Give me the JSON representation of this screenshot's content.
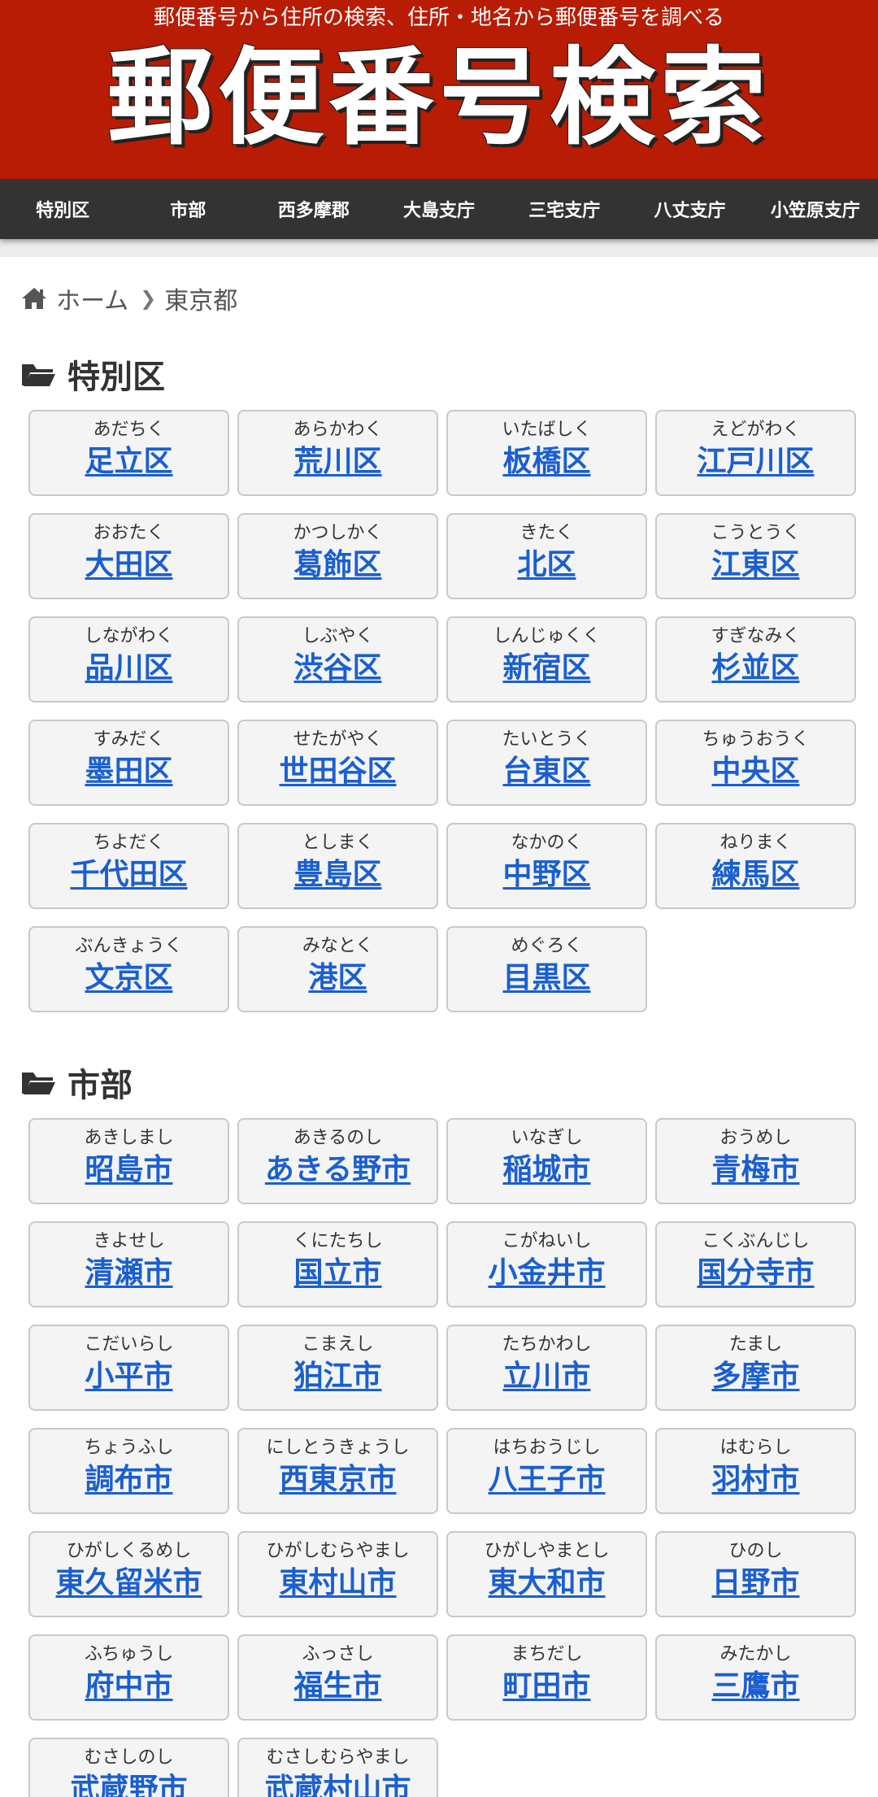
{
  "header": {
    "tagline": "郵便番号から住所の検索、住所・地名から郵便番号を調べる",
    "title": "郵便番号検索"
  },
  "nav": [
    "特別区",
    "市部",
    "西多摩郡",
    "大島支庁",
    "三宅支庁",
    "八丈支庁",
    "小笠原支庁"
  ],
  "breadcrumb": {
    "home": "ホーム",
    "current": "東京都"
  },
  "sections": [
    {
      "title": "特別区",
      "items": [
        {
          "kana": "あだちく",
          "name": "足立区"
        },
        {
          "kana": "あらかわく",
          "name": "荒川区"
        },
        {
          "kana": "いたばしく",
          "name": "板橋区"
        },
        {
          "kana": "えどがわく",
          "name": "江戸川区"
        },
        {
          "kana": "おおたく",
          "name": "大田区"
        },
        {
          "kana": "かつしかく",
          "name": "葛飾区"
        },
        {
          "kana": "きたく",
          "name": "北区"
        },
        {
          "kana": "こうとうく",
          "name": "江東区"
        },
        {
          "kana": "しながわく",
          "name": "品川区"
        },
        {
          "kana": "しぶやく",
          "name": "渋谷区"
        },
        {
          "kana": "しんじゅくく",
          "name": "新宿区"
        },
        {
          "kana": "すぎなみく",
          "name": "杉並区"
        },
        {
          "kana": "すみだく",
          "name": "墨田区"
        },
        {
          "kana": "せたがやく",
          "name": "世田谷区"
        },
        {
          "kana": "たいとうく",
          "name": "台東区"
        },
        {
          "kana": "ちゅうおうく",
          "name": "中央区"
        },
        {
          "kana": "ちよだく",
          "name": "千代田区"
        },
        {
          "kana": "としまく",
          "name": "豊島区"
        },
        {
          "kana": "なかのく",
          "name": "中野区"
        },
        {
          "kana": "ねりまく",
          "name": "練馬区"
        },
        {
          "kana": "ぶんきょうく",
          "name": "文京区"
        },
        {
          "kana": "みなとく",
          "name": "港区"
        },
        {
          "kana": "めぐろく",
          "name": "目黒区"
        }
      ]
    },
    {
      "title": "市部",
      "items": [
        {
          "kana": "あきしまし",
          "name": "昭島市"
        },
        {
          "kana": "あきるのし",
          "name": "あきる野市"
        },
        {
          "kana": "いなぎし",
          "name": "稲城市"
        },
        {
          "kana": "おうめし",
          "name": "青梅市"
        },
        {
          "kana": "きよせし",
          "name": "清瀬市"
        },
        {
          "kana": "くにたちし",
          "name": "国立市"
        },
        {
          "kana": "こがねいし",
          "name": "小金井市"
        },
        {
          "kana": "こくぶんじし",
          "name": "国分寺市"
        },
        {
          "kana": "こだいらし",
          "name": "小平市"
        },
        {
          "kana": "こまえし",
          "name": "狛江市"
        },
        {
          "kana": "たちかわし",
          "name": "立川市"
        },
        {
          "kana": "たまし",
          "name": "多摩市"
        },
        {
          "kana": "ちょうふし",
          "name": "調布市"
        },
        {
          "kana": "にしとうきょうし",
          "name": "西東京市"
        },
        {
          "kana": "はちおうじし",
          "name": "八王子市"
        },
        {
          "kana": "はむらし",
          "name": "羽村市"
        },
        {
          "kana": "ひがしくるめし",
          "name": "東久留米市"
        },
        {
          "kana": "ひがしむらやまし",
          "name": "東村山市"
        },
        {
          "kana": "ひがしやまとし",
          "name": "東大和市"
        },
        {
          "kana": "ひのし",
          "name": "日野市"
        },
        {
          "kana": "ふちゅうし",
          "name": "府中市"
        },
        {
          "kana": "ふっさし",
          "name": "福生市"
        },
        {
          "kana": "まちだし",
          "name": "町田市"
        },
        {
          "kana": "みたかし",
          "name": "三鷹市"
        },
        {
          "kana": "むさしのし",
          "name": "武蔵野市"
        },
        {
          "kana": "むさしむらやまし",
          "name": "武蔵村山市"
        }
      ]
    }
  ],
  "icons": {
    "home": "home-icon",
    "folder": "folder-open-icon",
    "separator": "chevron-right-icon"
  },
  "colors": {
    "header": "#b81c04",
    "nav": "#333333",
    "link": "#1a5fd0"
  }
}
